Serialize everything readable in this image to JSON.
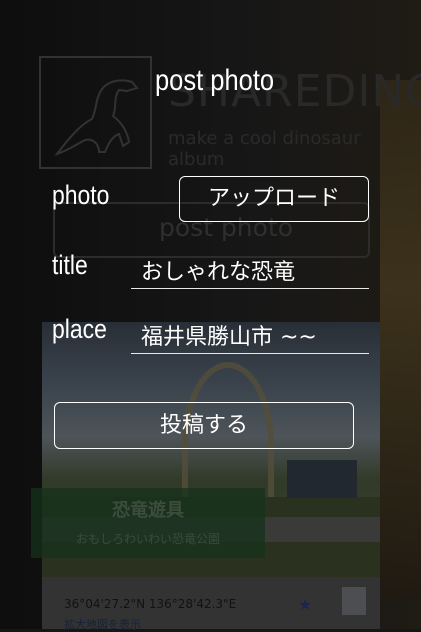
{
  "background": {
    "brand": "SHAREDINO",
    "tagline": "make a cool dinosaur album",
    "post_button_label": "post photo",
    "card": {
      "title": "恐竜遊具",
      "subtitle": "おもしろわいわい恐竜公園"
    },
    "map": {
      "coords": "36°04'27.2\"N 136°28'42.3\"E",
      "link": "拡大地図を表示"
    }
  },
  "modal": {
    "title": "post photo",
    "photo": {
      "label": "photo",
      "upload_button": "アップロード"
    },
    "title_field": {
      "label": "title",
      "value": "おしゃれな恐竜"
    },
    "place_field": {
      "label": "place",
      "value": "福井県勝山市 ~~"
    },
    "submit_button": "投稿する"
  }
}
